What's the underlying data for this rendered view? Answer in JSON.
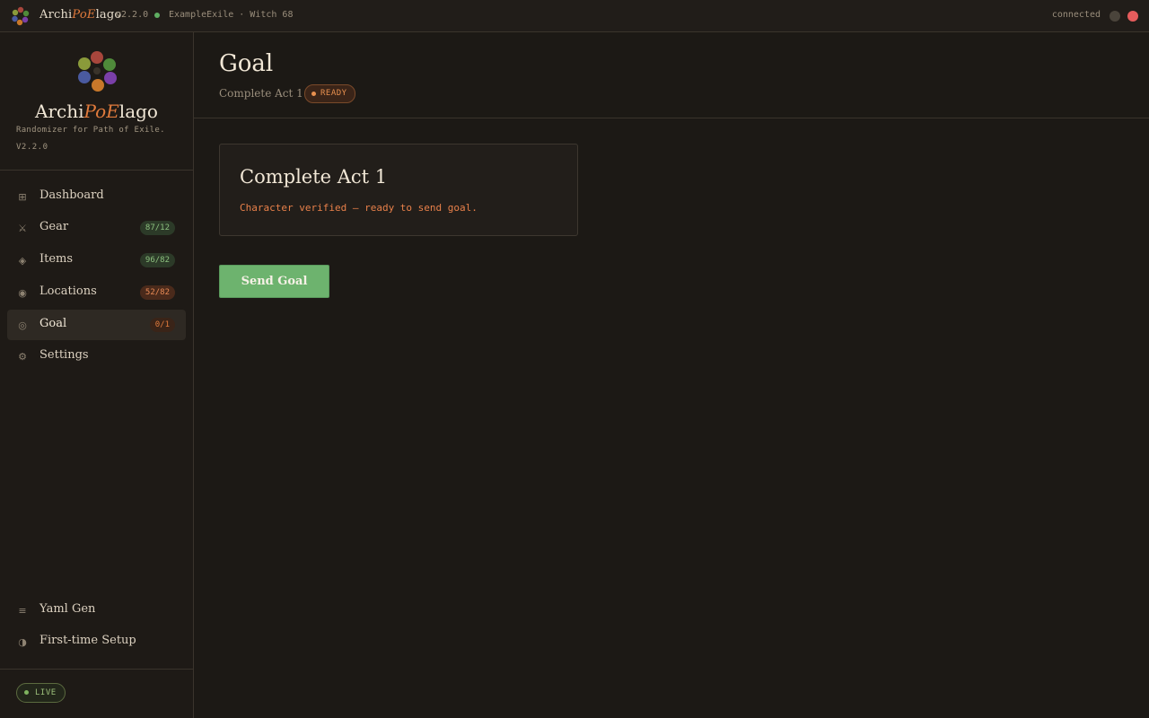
{
  "titlebar": {
    "app_name_prefix": "Archi",
    "app_name_accent": "PoE",
    "app_name_suffix": "lago",
    "version": "v2.2.0",
    "character": "ExampleExile · Witch 68",
    "connection_status": "connected",
    "colors": {
      "connected_dot": "#5fae62",
      "close": "#e65c5c"
    }
  },
  "sidebar": {
    "brand": {
      "name_prefix": "Archi",
      "name_accent": "PoE",
      "name_suffix": "lago",
      "tagline": "Randomizer for Path of Exile.",
      "version": "V2.2.0"
    },
    "nav": [
      {
        "label": "Dashboard",
        "icon": "grid-icon",
        "badge": ""
      },
      {
        "label": "Gear",
        "icon": "swords-icon",
        "badge": "87/12"
      },
      {
        "label": "Items",
        "icon": "diamond-icon",
        "badge": "96/82"
      },
      {
        "label": "Locations",
        "icon": "target-icon",
        "badge": "52/82"
      },
      {
        "label": "Goal",
        "icon": "goal-icon",
        "badge": "0/1",
        "active": true
      },
      {
        "label": "Settings",
        "icon": "gear-icon",
        "badge": ""
      }
    ],
    "bottom_nav": [
      {
        "label": "Yaml Gen",
        "icon": "menu-icon"
      },
      {
        "label": "First-time Setup",
        "icon": "half-circle-icon"
      }
    ],
    "live_label": "LIVE"
  },
  "main": {
    "title": "Goal",
    "subtitle": "Complete Act 1",
    "status": "READY",
    "goal_card": {
      "title": "Complete Act 1",
      "message": "Character verified — ready to send goal."
    },
    "send_button": "Send Goal",
    "colors": {
      "accent": "#e07a3c",
      "button": "#6db36e"
    }
  }
}
